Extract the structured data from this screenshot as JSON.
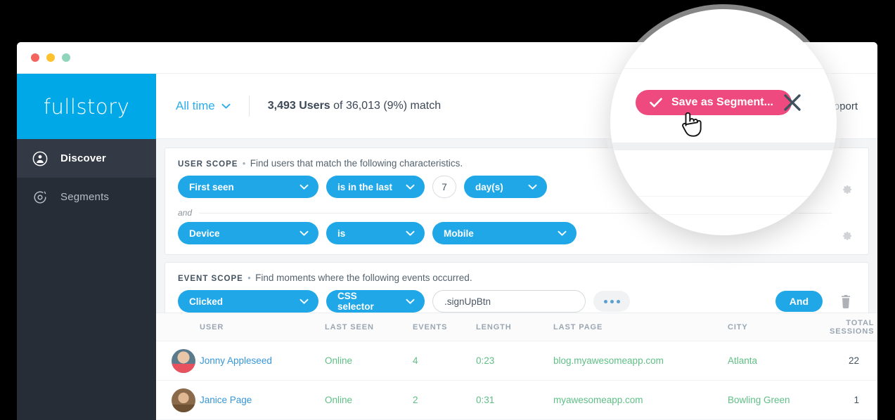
{
  "window": {
    "traffic_lights": [
      "close",
      "minimize",
      "maximize"
    ]
  },
  "sidebar": {
    "logo": "fullstory",
    "items": [
      {
        "label": "Discover",
        "icon": "user-circle-icon",
        "active": true
      },
      {
        "label": "Segments",
        "icon": "target-circle-icon",
        "active": false
      }
    ]
  },
  "topbar": {
    "date_range": "All time",
    "date_range_icon": "chevron-down-icon",
    "match_count": "3,493 Users",
    "match_suffix": " of 36,013 (9%) match",
    "support": "Support"
  },
  "user_scope": {
    "caps": "USER SCOPE",
    "separator": "•",
    "description": "Find users that match the following characteristics.",
    "conjunction": "and",
    "rows": [
      {
        "field": "First seen",
        "operator": "is in the last",
        "number": "7",
        "unit": "day(s)",
        "gear": "gear-icon"
      },
      {
        "field": "Device",
        "operator": "is",
        "value": "Mobile",
        "gear": "gear-icon"
      }
    ]
  },
  "event_scope": {
    "caps": "EVENT SCOPE",
    "separator": "•",
    "description": "Find moments where the following events occurred.",
    "row": {
      "action": "Clicked",
      "target_type": "CSS selector",
      "selector_value": ".signUpBtn",
      "selector_placeholder": "CSS selector",
      "more_label": "•••",
      "and_label": "And",
      "delete_icon": "trash-icon"
    }
  },
  "table": {
    "columns": [
      "USER",
      "LAST SEEN",
      "EVENTS",
      "LENGTH",
      "LAST PAGE",
      "CITY",
      "TOTAL SESSIONS"
    ],
    "rows": [
      {
        "avatar": "avatar-jonny",
        "user": "Jonny Appleseed",
        "last_seen": "Online",
        "events": "4",
        "length": "0:23",
        "last_page": "blog.myawesomeapp.com",
        "city": "Atlanta",
        "total_sessions": "22"
      },
      {
        "avatar": "avatar-janice",
        "user": "Janice Page",
        "last_seen": "Online",
        "events": "2",
        "length": "0:31",
        "last_page": "myawesomeapp.com",
        "city": "Bowling Green",
        "total_sessions": "1"
      }
    ]
  },
  "magnifier": {
    "save_button": "Save as Segment...",
    "save_check_icon": "check-icon",
    "close_icon": "close-x-icon",
    "cursor": "pointing-hand-cursor"
  },
  "colors": {
    "brand_blue": "#00a8e8",
    "pill_blue": "#1fa7e8",
    "accent_pink": "#ef4a7f",
    "sidebar_dark": "#272d36",
    "online_green": "#5fbf86",
    "link_blue": "#3796d8"
  }
}
